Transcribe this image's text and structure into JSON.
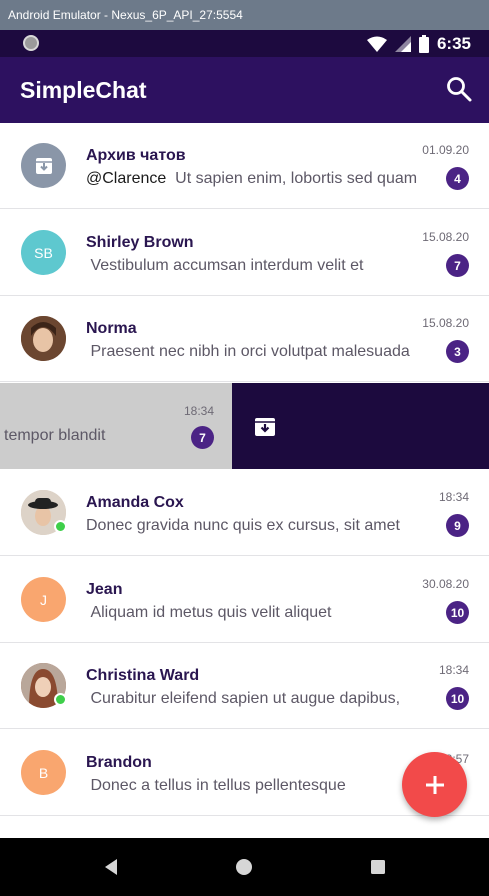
{
  "window_title": "Android Emulator - Nexus_6P_API_27:5554",
  "status": {
    "time": "6:35"
  },
  "app_bar": {
    "title": "SimpleChat",
    "search_icon": "search-icon"
  },
  "colors": {
    "primary": "#2d1160",
    "status_bar": "#1d0a3f",
    "badge": "#4b2385",
    "fab": "#f24a4a",
    "swipe_bg": "#1c0a3e"
  },
  "chats": [
    {
      "name": "Архив чатов",
      "mention": "@Clarence",
      "preview": "Ut sapien enim, lobortis sed quam",
      "date": "01.09.20",
      "badge": "4",
      "avatar_type": "archive-icon",
      "avatar_color": "#8a96a8"
    },
    {
      "name": "Shirley Brown",
      "mention": "",
      "preview": "Vestibulum accumsan interdum velit et",
      "date": "15.08.20",
      "badge": "7",
      "avatar_type": "initials",
      "initials": "SB",
      "avatar_color": "#5ec8cf"
    },
    {
      "name": "Norma",
      "mention": "",
      "preview": "Praesent nec nibh in orci volutpat malesuada",
      "date": "15.08.20",
      "badge": "3",
      "avatar_type": "photo",
      "avatar_color": "#8b5a3e"
    },
    {
      "name": "Amanda Cox",
      "mention": "",
      "preview": "Donec gravida nunc quis ex cursus, sit amet",
      "date": "18:34",
      "badge": "9",
      "avatar_type": "photo",
      "avatar_color": "#c9a586",
      "online": true
    },
    {
      "name": "Jean",
      "mention": "",
      "preview": "Aliquam id metus quis velit aliquet",
      "date": "30.08.20",
      "badge": "10",
      "avatar_type": "initials",
      "initials": "J",
      "avatar_color": "#f9a66f"
    },
    {
      "name": "Christina Ward",
      "mention": "",
      "preview": "Curabitur eleifend sapien ut augue dapibus,",
      "date": "18:34",
      "badge": "10",
      "avatar_type": "photo",
      "avatar_color": "#a8624a",
      "online": true
    },
    {
      "name": "Brandon",
      "mention": "",
      "preview": "Donec a tellus in tellus pellentesque",
      "date": "",
      "badge": "",
      "avatar_type": "initials",
      "initials": "B",
      "avatar_color": "#f9a66f"
    }
  ],
  "swiped_chat": {
    "preview": "tempor blandit",
    "time": "18:34",
    "badge": "7",
    "action_icon": "archive-icon"
  },
  "fab": {
    "icon": "plus-icon",
    "label": "+",
    "behind_time": "18:57"
  },
  "nav": {
    "back": "back-icon",
    "home": "home-icon",
    "recents": "recents-icon"
  }
}
